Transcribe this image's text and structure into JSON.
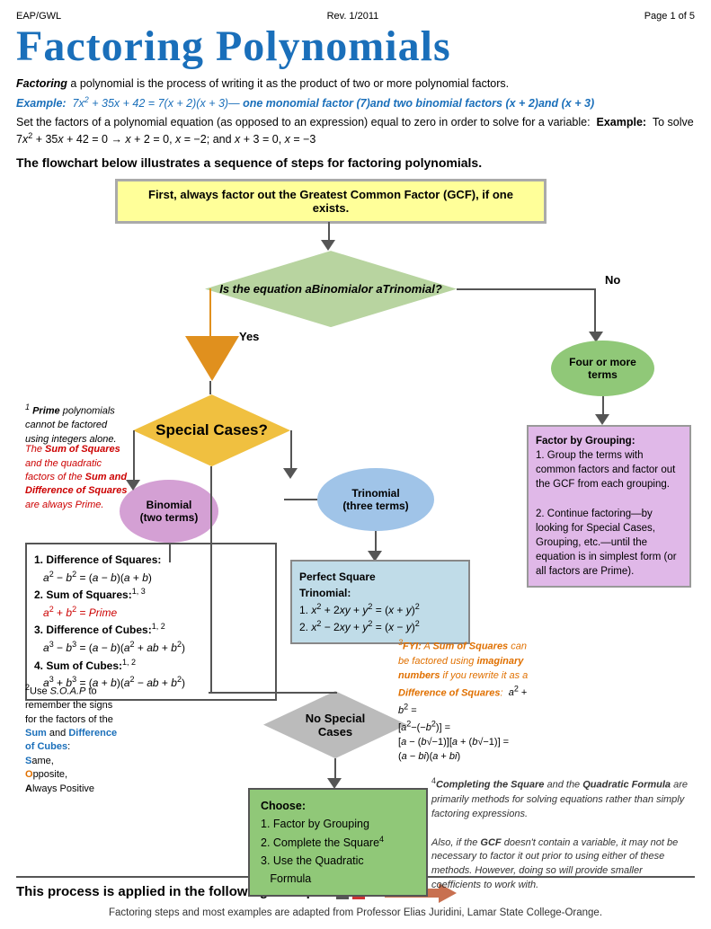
{
  "header": {
    "left": "EAP/GWL",
    "center": "Rev. 1/2011",
    "right": "Page 1 of 5"
  },
  "title": "Factoring Polynomials",
  "intro": {
    "factoring_def": "Factoring a polynomial is the process of writing it as the product of two or more polynomial factors.",
    "example_label": "Example:",
    "example_eq": "7x² + 35x + 42 = 7(x + 2)(x + 3)—",
    "example_desc": "one monomial factor (7)and two binomial factors (x + 2)and (x + 3)",
    "set_text": "Set the factors of a polynomial equation (as opposed to an expression) equal to zero in order to solve for a",
    "set_text2": "variable:",
    "set_example": "Example: To solve 7x² + 35x + 42 = 0 → x + 2 = 0, x = −2; and x + 3 = 0, x = −3"
  },
  "flowchart_title": "The flowchart below illustrates a sequence of steps for factoring polynomials.",
  "gcf_box": "First, always factor out the Greatest Common Factor (GCF), if one exists.",
  "diamond_q": "Is the equation a Binomial or a Trinomial?",
  "yes_label": "Yes",
  "no_label": "No",
  "special_cases": "Special Cases?",
  "binomial_label": "Binomial\n(two terms)",
  "trinomial_label": "Trinomial\n(three terms)",
  "four_more": "Four or more\nterms",
  "list_items": [
    "Difference of Squares:\na² − b² = (a − b)(a + b)",
    "Sum of Squares:¹ ³\na² + b² = Prime",
    "Difference of Cubes:¹ ²\na³ − b³ = (a − b)(a² + ab + b²)",
    "Sum of Cubes:¹ ²\na³ + b³ = (a + b)(a² − ab + b²)"
  ],
  "perfect_sq": {
    "title": "Perfect Square\nTrinomial:",
    "item1": "1. x² + 2xy + y² = (x + y)²",
    "item2": "2. x² − 2xy + y² = (x − y)²"
  },
  "grouping_box": {
    "title": "Factor by Grouping:",
    "item1": "1. Group the terms with common factors and factor out the GCF from each grouping.",
    "item2": "2. Continue factoring—by looking for Special Cases, Grouping, etc.—until the equation is in simplest form (or all factors are Prime)."
  },
  "no_special": "No Special\nCases",
  "choose_box": {
    "title": "Choose:",
    "item1": "1. Factor by Grouping",
    "item2": "2. Complete the Square⁴",
    "item3": "3. Use the Quadratic\nFormula"
  },
  "note1": "¹ Prime polynomials cannot be factored using integers alone.",
  "note2_title": "The Sum of Squares and the quadratic factors of the Sum and Difference of Squares are always Prime.",
  "note2": "²Use S.O.A.P to remember the signs for the factors of the Sum and Difference of Cubes:",
  "soaps": "Same, Opposite, Always Positive",
  "note3": "³FYI: A Sum of Squares can be factored using imaginary numbers if you rewrite it as a Difference of Squares:",
  "note3_eq": "a² + b² = [a² − (−b²)] = [a − (b√−1)][a + (b√−1)] = (a − bi)(a + bi)",
  "note4": "⁴Completing the Square and the Quadratic Formula are primarily methods for solving equations rather than simply factoring expressions.",
  "note4b": "Also, if the GCF doesn't contain a variable, it may not be necessary to factor it out prior to using either of these methods. However, doing so will provide smaller coefficients to work with.",
  "footer": {
    "title": "This process is applied in the following examples",
    "note": "Factoring steps and most examples are adapted from Professor Elias Juridini, Lamar State College-Orange."
  }
}
